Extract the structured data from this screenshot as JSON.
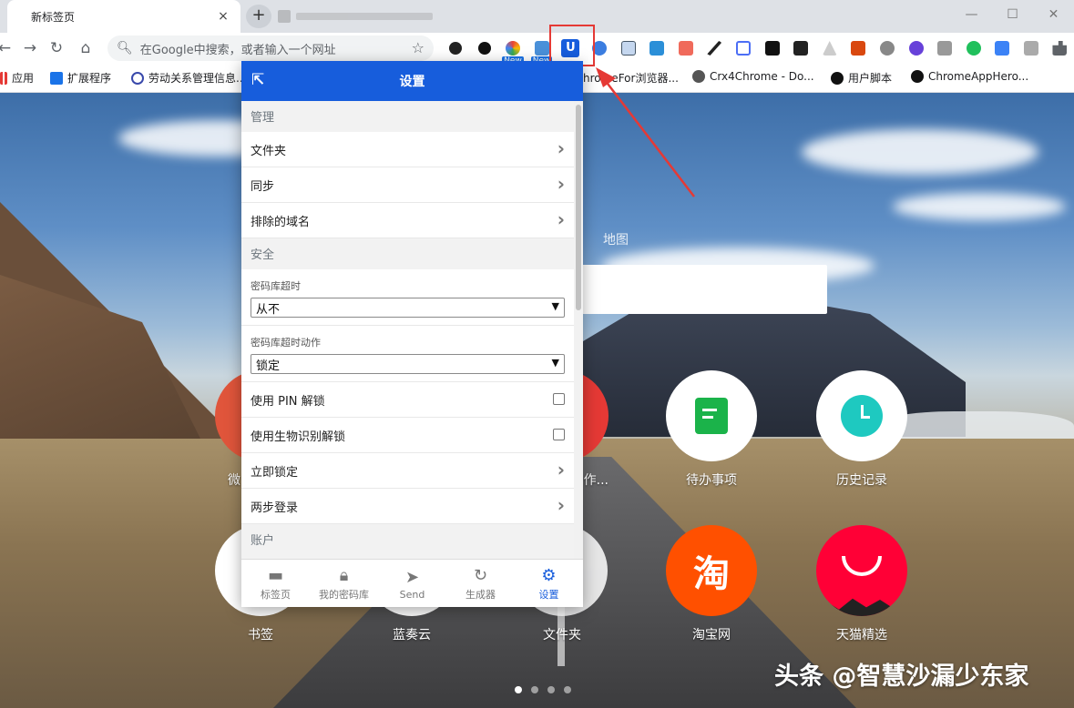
{
  "browser": {
    "tab_title": "新标签页",
    "tab_close": "×",
    "new_tab": "+",
    "omnibox_placeholder": "在Google中搜索，或者输入一个网址",
    "new_badge": "New",
    "bitwarden_glyph": "U"
  },
  "bookmarks": [
    {
      "label": "应用",
      "icon": "apps-grid-icon"
    },
    {
      "label": "扩展程序",
      "icon": "puzzle-icon"
    },
    {
      "label": "劳动关系管理信息...",
      "icon": "globe-icon"
    },
    {
      "label": "hromeFor浏览器...",
      "icon": "page-icon"
    },
    {
      "label": "Crx4Chrome - Do...",
      "icon": "crx-icon"
    },
    {
      "label": "用户脚本",
      "icon": "userscript-icon"
    },
    {
      "label": "ChromeAppHero...",
      "icon": "github-icon"
    }
  ],
  "ntp": {
    "map_label": "地图",
    "tiles_row1": [
      {
        "label": "微",
        "color": "#e0553b"
      },
      {
        "label": "作...",
        "color": "#e53935"
      },
      {
        "label": "待办事项",
        "color": "#ffffff"
      },
      {
        "label": "历史记录",
        "color": "#ffffff"
      }
    ],
    "tiles_row2": [
      {
        "label": "书签",
        "color": "#ffffff"
      },
      {
        "label": "蓝奏云",
        "color": "#ffffff"
      },
      {
        "label": "文件夹",
        "color": "#ffffff"
      },
      {
        "label": "淘宝网",
        "color": "#ff5000"
      },
      {
        "label": "天猫精选",
        "color": "#ff0036"
      }
    ],
    "taobao_glyph": "淘",
    "watermark": "头条 @智慧沙漏少东家"
  },
  "popup": {
    "title": "设置",
    "sections": {
      "manage": "管理",
      "security": "安全",
      "account": "账户"
    },
    "manage_items": [
      "文件夹",
      "同步",
      "排除的域名"
    ],
    "vault_timeout_label": "密码库超时",
    "vault_timeout_value": "从不",
    "vault_timeout_action_label": "密码库超时动作",
    "vault_timeout_action_value": "锁定",
    "pin_unlock": "使用 PIN 解锁",
    "biometric_unlock": "使用生物识别解锁",
    "lock_now": "立即锁定",
    "two_step": "两步登录",
    "tabs": [
      {
        "label": "标签页",
        "icon": "folder-icon"
      },
      {
        "label": "我的密码库",
        "icon": "lock-icon"
      },
      {
        "label": "Send",
        "icon": "send-icon"
      },
      {
        "label": "生成器",
        "icon": "refresh-icon"
      },
      {
        "label": "设置",
        "icon": "gears-icon"
      }
    ]
  }
}
